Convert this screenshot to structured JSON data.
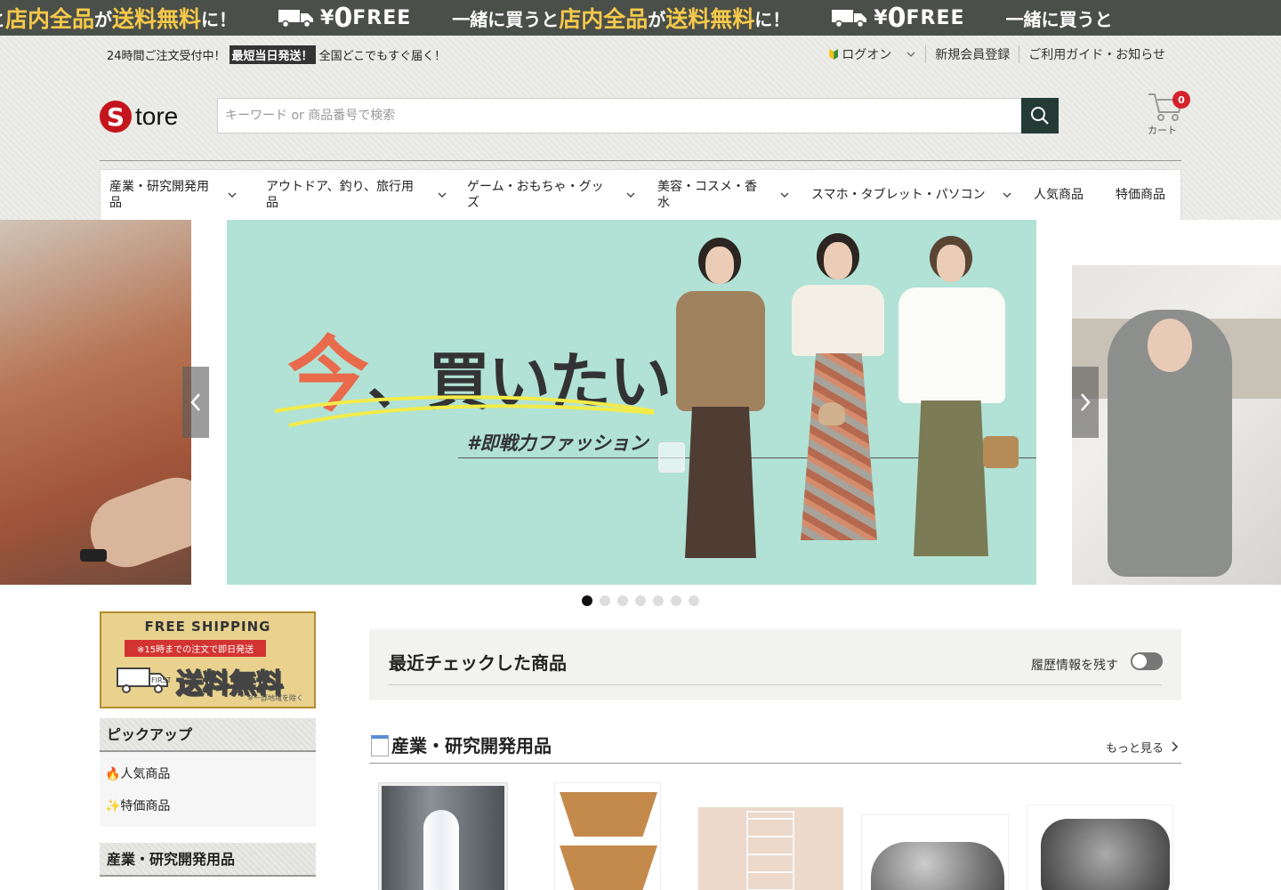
{
  "ticker": {
    "seg_prefix": "一緒に買うと",
    "seg_a": "店内全品",
    "seg_ga": "が",
    "seg_b": "送料無料",
    "seg_ni": "に！",
    "start_fragment": "と",
    "yen": "¥",
    "zero": "0",
    "free": "FREE"
  },
  "topbar": {
    "order_text": "24時間ご注文受付中！",
    "highlight": "最短当日発送！",
    "delivery_text": "全国どこでもすぐ届く！",
    "login": "ログオン",
    "register": "新規会員登録",
    "guide": "ご利用ガイド・お知らせ"
  },
  "logo": {
    "s": "S",
    "text": "tore"
  },
  "search": {
    "placeholder": "キーワード or 商品番号で検索"
  },
  "cart": {
    "count": "0",
    "label": "カート"
  },
  "nav": [
    {
      "label": "産業・研究開発用品"
    },
    {
      "label": "アウトドア、釣り、旅行用品"
    },
    {
      "label": "ゲーム・おもちゃ・グッズ"
    },
    {
      "label": "美容・コスメ・香水"
    },
    {
      "label": "スマホ・タブレット・パソコン"
    },
    {
      "label": "人気商品"
    },
    {
      "label": "特価商品"
    }
  ],
  "banner": {
    "headline_big": "今",
    "headline_rest": "、買いたい！",
    "tagline": "#即戦力ファッション"
  },
  "carousel": {
    "slide_count": 7,
    "active_index": 0
  },
  "sidebar": {
    "free_shipping_title": "FREE SHIPPING",
    "free_shipping_sub": "※15時までの注文で即日発送",
    "free_shipping_big": "送料無料",
    "free_shipping_note": "※一部地域を除く",
    "truck_label": "FIRST",
    "pickup_title": "ピックアップ",
    "links": [
      "🔥人気商品",
      "✨特価商品"
    ],
    "category_title": "産業・研究開発用品"
  },
  "recent": {
    "title": "最近チェックした商品",
    "toggle_label": "履歴情報を残す",
    "toggle_on": false
  },
  "section": {
    "title": "産業・研究開発用品",
    "more": "もっと見る"
  },
  "colors": {
    "ticker_bg": "#4b4f49",
    "ticker_accent": "#f6c94a",
    "logo_red": "#c4151c",
    "search_button": "#233a36",
    "cart_badge": "#d3242b",
    "banner_bg": "#b1e2d5",
    "headline_accent": "#ea6b4c"
  }
}
